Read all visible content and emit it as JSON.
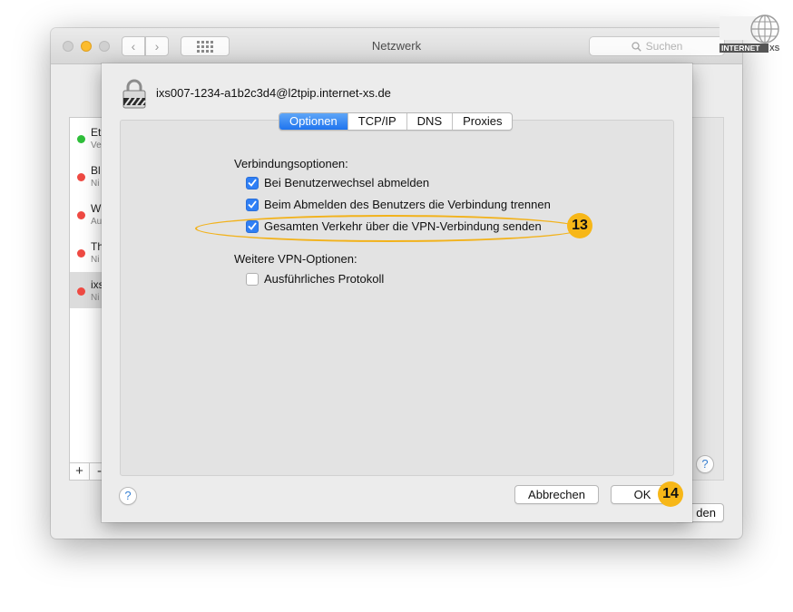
{
  "window": {
    "title": "Netzwerk",
    "search_placeholder": "Suchen",
    "back_icon": "‹",
    "forward_icon": "›"
  },
  "sidebar": {
    "items": [
      {
        "name": "Et",
        "status": "Ve",
        "color": "#2fbf3a"
      },
      {
        "name": "Bl",
        "status": "Ni",
        "color": "#ef4a43"
      },
      {
        "name": "W",
        "status": "Au",
        "color": "#ef4a43"
      },
      {
        "name": "Th",
        "status": "Ni",
        "color": "#ef4a43"
      },
      {
        "name": "ixs",
        "status": "Ni",
        "color": "#ef4a43"
      }
    ],
    "add_label": "+",
    "remove_label": "-"
  },
  "window_buttons": {
    "apply_fragment": "den",
    "help": "?"
  },
  "sheet": {
    "vpn_name": "ixs007-1234-a1b2c3d4@l2tpip.internet-xs.de",
    "tabs": [
      {
        "label": "Optionen",
        "active": true
      },
      {
        "label": "TCP/IP",
        "active": false
      },
      {
        "label": "DNS",
        "active": false
      },
      {
        "label": "Proxies",
        "active": false
      }
    ],
    "section1": "Verbindungsoptionen:",
    "options": [
      {
        "label": "Bei Benutzerwechsel abmelden",
        "checked": true
      },
      {
        "label": "Beim Abmelden des Benutzers die Verbindung trennen",
        "checked": true
      },
      {
        "label": "Gesamten Verkehr über die VPN-Verbindung senden",
        "checked": true
      }
    ],
    "section2": "Weitere VPN-Optionen:",
    "more_options": [
      {
        "label": "Ausführliches Protokoll",
        "checked": false
      }
    ],
    "cancel_label": "Abbrechen",
    "ok_label": "OK",
    "help": "?"
  },
  "annotations": {
    "step13": "13",
    "step14": "14",
    "highlight_color": "#f2b21b"
  },
  "logo": {
    "text_left": "INTERNET",
    "text_right": "XS"
  }
}
